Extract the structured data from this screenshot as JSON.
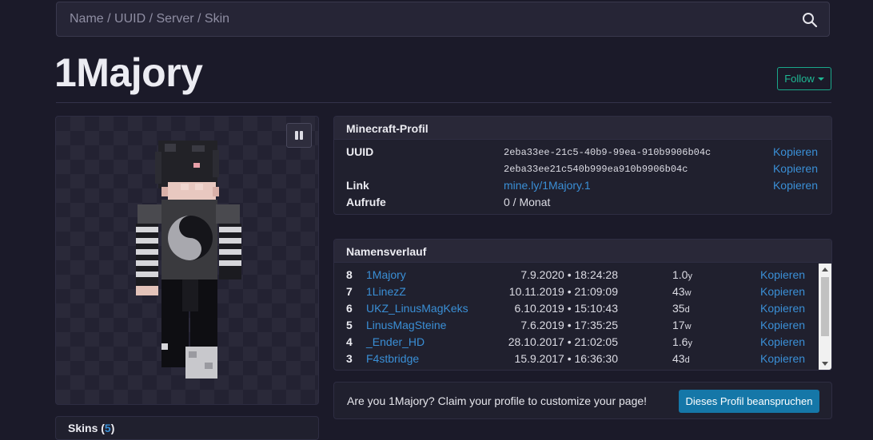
{
  "search": {
    "placeholder": "Name / UUID / Server / Skin"
  },
  "profile": {
    "name": "1Majory",
    "follow_label": "Follow"
  },
  "skins_card": {
    "label": "Skins",
    "count": "5"
  },
  "minecraft_profile": {
    "header": "Minecraft-Profil",
    "uuid_label": "UUID",
    "uuid": "2eba33ee-21c5-40b9-99ea-910b9906b04c",
    "uuid_plain": "2eba33ee21c540b999ea910b9906b04c",
    "link_label": "Link",
    "link": "mine.ly/1Majory.1",
    "views_label": "Aufrufe",
    "views": "0 / Monat",
    "copy_label": "Kopieren"
  },
  "name_history": {
    "header": "Namensverlauf",
    "copy_label": "Kopieren",
    "rows": [
      {
        "num": "8",
        "name": "1Majory",
        "date": "7.9.2020 • 18:24:28",
        "dur": "1.0",
        "unit": "y"
      },
      {
        "num": "7",
        "name": "1LinezZ",
        "date": "10.11.2019 • 21:09:09",
        "dur": "43",
        "unit": "w"
      },
      {
        "num": "6",
        "name": "UKZ_LinusMagKeks",
        "date": "6.10.2019 • 15:10:43",
        "dur": "35",
        "unit": "d"
      },
      {
        "num": "5",
        "name": "LinusMagSteine",
        "date": "7.6.2019 • 17:35:25",
        "dur": "17",
        "unit": "w"
      },
      {
        "num": "4",
        "name": "_Ender_HD",
        "date": "28.10.2017 • 21:02:05",
        "dur": "1.6",
        "unit": "y"
      },
      {
        "num": "3",
        "name": "F4stbridge",
        "date": "15.9.2017 • 16:36:30",
        "dur": "43",
        "unit": "d"
      }
    ]
  },
  "claim": {
    "text": "Are you 1Majory? Claim your profile to customize your page!",
    "button": "Dieses Profil beanspruchen"
  },
  "colors": {
    "background": "#1b1a29",
    "accent_link": "#3a8fd6",
    "follow": "#1fb894",
    "claim_button": "#1577a8"
  },
  "icons": {
    "search": "search-icon",
    "pause": "pause-icon",
    "follow_caret": "caret-down-icon"
  }
}
